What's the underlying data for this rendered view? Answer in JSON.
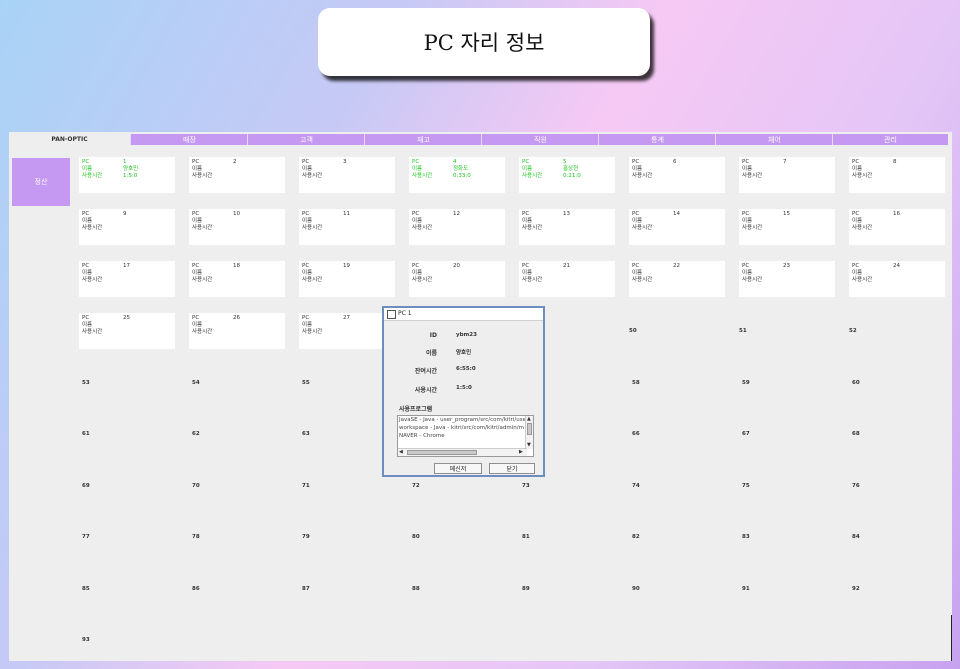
{
  "title": "PC 자리 정보",
  "nav": {
    "brand": "PAN-OPTIC",
    "tabs": [
      "매장",
      "고객",
      "재고",
      "직원",
      "통계",
      "채어",
      "관리"
    ]
  },
  "sidebar": {
    "button_label": "정산"
  },
  "card_labels": {
    "pc": "PC",
    "name": "이름",
    "time": "사용시간"
  },
  "active_color": "#19c419",
  "tab_color": "#c598f2",
  "pc_cards": [
    {
      "num": "1",
      "name": "양호민",
      "time": "1:5:0",
      "active": true
    },
    {
      "num": "2",
      "name": "",
      "time": "",
      "active": false
    },
    {
      "num": "3",
      "name": "",
      "time": "",
      "active": false
    },
    {
      "num": "4",
      "name": "정화도",
      "time": "0:33:0",
      "active": true
    },
    {
      "num": "5",
      "name": "홍상현",
      "time": "0:21:0",
      "active": true
    },
    {
      "num": "6",
      "name": "",
      "time": "",
      "active": false
    },
    {
      "num": "7",
      "name": "",
      "time": "",
      "active": false
    },
    {
      "num": "8",
      "name": "",
      "time": "",
      "active": false
    },
    {
      "num": "9",
      "name": "",
      "time": "",
      "active": false
    },
    {
      "num": "10",
      "name": "",
      "time": "",
      "active": false
    },
    {
      "num": "11",
      "name": "",
      "time": "",
      "active": false
    },
    {
      "num": "12",
      "name": "",
      "time": "",
      "active": false
    },
    {
      "num": "13",
      "name": "",
      "time": "",
      "active": false
    },
    {
      "num": "14",
      "name": "",
      "time": "",
      "active": false
    },
    {
      "num": "15",
      "name": "",
      "time": "",
      "active": false
    },
    {
      "num": "16",
      "name": "",
      "time": "",
      "active": false
    },
    {
      "num": "17",
      "name": "",
      "time": "",
      "active": false
    },
    {
      "num": "18",
      "name": "",
      "time": "",
      "active": false
    },
    {
      "num": "19",
      "name": "",
      "time": "",
      "active": false
    },
    {
      "num": "20",
      "name": "",
      "time": "",
      "active": false
    },
    {
      "num": "21",
      "name": "",
      "time": "",
      "active": false
    },
    {
      "num": "22",
      "name": "",
      "time": "",
      "active": false
    },
    {
      "num": "23",
      "name": "",
      "time": "",
      "active": false
    },
    {
      "num": "24",
      "name": "",
      "time": "",
      "active": false
    },
    {
      "num": "25",
      "name": "",
      "time": "",
      "active": false
    },
    {
      "num": "26",
      "name": "",
      "time": "",
      "active": false
    },
    {
      "num": "27",
      "name": "",
      "time": "",
      "active": false
    }
  ],
  "seat_numbers": [
    "50",
    "51",
    "52",
    "53",
    "54",
    "55",
    "58",
    "59",
    "60",
    "61",
    "62",
    "63",
    "66",
    "67",
    "68",
    "69",
    "70",
    "71",
    "72",
    "73",
    "74",
    "75",
    "76",
    "77",
    "78",
    "79",
    "80",
    "81",
    "82",
    "83",
    "84",
    "85",
    "86",
    "87",
    "88",
    "89",
    "90",
    "91",
    "92",
    "93"
  ],
  "dialog": {
    "title": "PC 1",
    "id_label": "ID",
    "id_value": "ybm23",
    "name_label": "이름",
    "name_value": "양호민",
    "total_label": "잔여시간",
    "total_value": "6:55:0",
    "used_label": "사용시간",
    "used_value": "1:5:0",
    "programs_label": "사용프로그램",
    "programs": [
      "JavaSE - Java - user_program/src/com/kitri/user",
      "workspace - Java - kitri/src/com/kitri/admin/m",
      "NAVER - Chrome"
    ],
    "message_button": "메신저",
    "close_button": "닫기"
  }
}
